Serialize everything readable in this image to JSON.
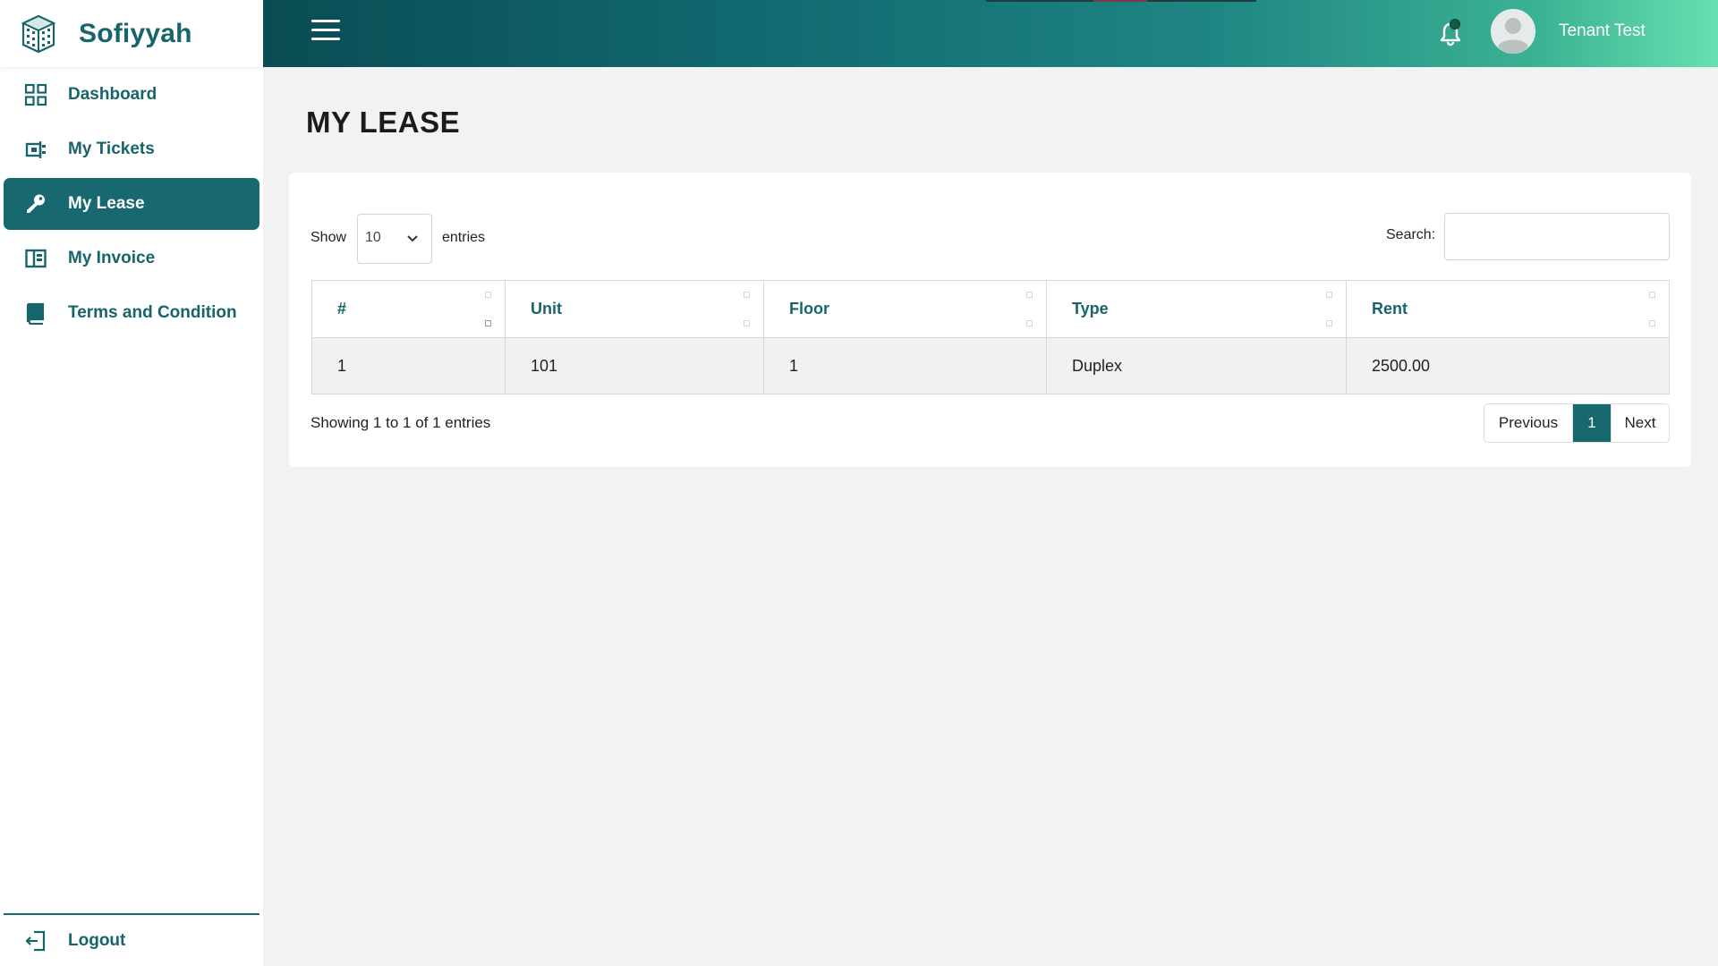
{
  "brand": {
    "name": "Sofiyyah",
    "icon": "building-icon"
  },
  "sidebar": {
    "items": [
      {
        "label": "Dashboard",
        "icon": "grid-icon"
      },
      {
        "label": "My Tickets",
        "icon": "ticket-icon"
      },
      {
        "label": "My Lease",
        "icon": "key-icon",
        "active": true
      },
      {
        "label": "My Invoice",
        "icon": "invoice-icon"
      },
      {
        "label": "Terms and Condition",
        "icon": "book-icon"
      }
    ],
    "logout": {
      "label": "Logout",
      "icon": "logout-icon"
    }
  },
  "header": {
    "menu_icon": "hamburger-icon",
    "notification_icon": "bell-icon",
    "user_name": "Tenant Test"
  },
  "page": {
    "title": "MY LEASE"
  },
  "table_controls": {
    "show_label": "Show",
    "length_value": "10",
    "entries_label": "entries",
    "search_label": "Search:",
    "search_value": ""
  },
  "table": {
    "columns": [
      "#",
      "Unit",
      "Floor",
      "Type",
      "Rent"
    ],
    "rows": [
      [
        "1",
        "101",
        "1",
        "Duplex",
        "2500.00"
      ]
    ]
  },
  "footer": {
    "info": "Showing 1 to 1 of 1 entries",
    "pagination": {
      "previous": "Previous",
      "current": "1",
      "next": "Next"
    }
  },
  "colors": {
    "accent": "#17686f",
    "header_start": "#0a4c54",
    "header_end": "#66e0b0"
  }
}
